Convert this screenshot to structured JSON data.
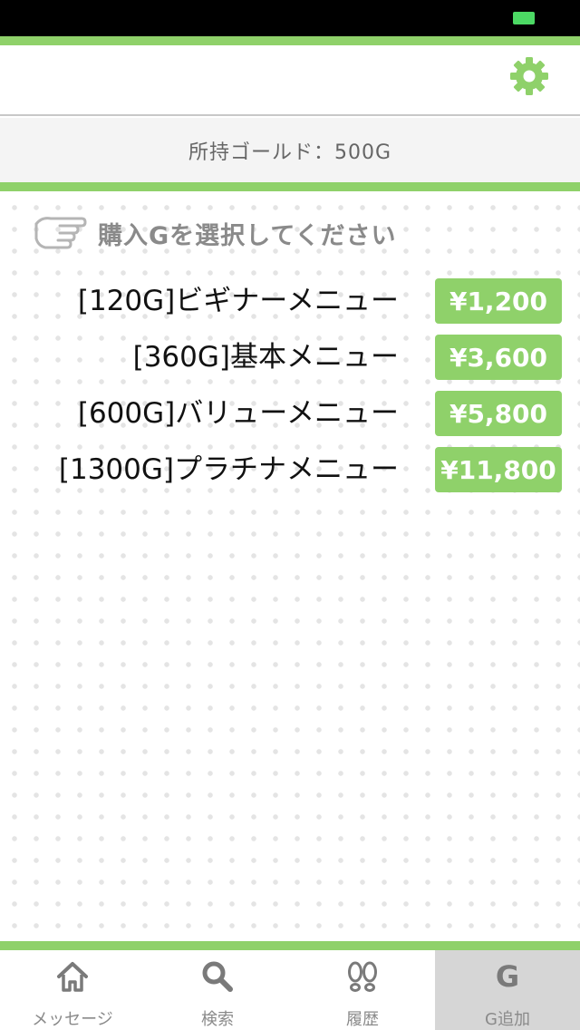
{
  "colors": {
    "accent": "#8fd16a",
    "status_bar": "#000000",
    "battery": "#4cd964",
    "text_muted": "#8a8a8a",
    "active_tab_bg": "#d6d6d6"
  },
  "header": {
    "settings_icon": "gear-icon"
  },
  "gold": {
    "label": "所持ゴールド：500G"
  },
  "instruction": {
    "icon": "pointing-hand-icon",
    "text": "購入Gを選択してください"
  },
  "plans": [
    {
      "name": "[120G]ビギナーメニュー",
      "price": "¥1,200"
    },
    {
      "name": "[360G]基本メニュー",
      "price": "¥3,600"
    },
    {
      "name": "[600G]バリューメニュー",
      "price": "¥5,800"
    },
    {
      "name": "[1300G]プラチナメニュー",
      "price": "¥11,800"
    }
  ],
  "tabs": [
    {
      "label": "メッセージ",
      "icon": "home-icon"
    },
    {
      "label": "検索",
      "icon": "search-icon"
    },
    {
      "label": "履歴",
      "icon": "footprints-icon"
    },
    {
      "label": "G追加",
      "icon_text": "G",
      "active": true
    }
  ]
}
